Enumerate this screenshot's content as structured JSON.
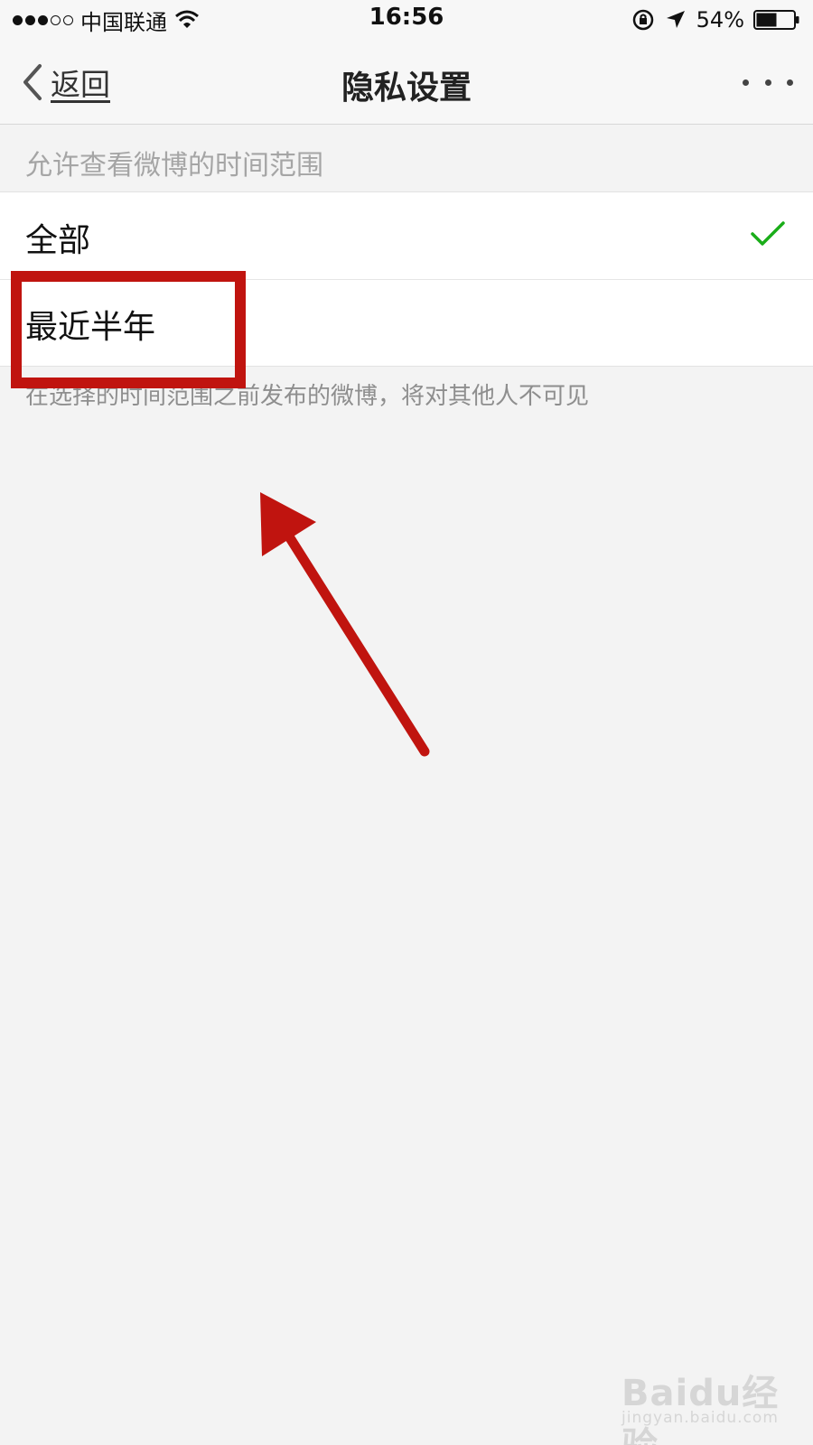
{
  "status_bar": {
    "carrier": "中国联通",
    "time": "16:56",
    "battery": "54%",
    "signal_bars_filled": 3,
    "signal_bars_total": 5
  },
  "nav": {
    "back_label": "返回",
    "title": "隐私设置",
    "more_icon": "more-dots-icon"
  },
  "section": {
    "header": "允许查看微博的时间范围",
    "options": [
      {
        "label": "全部",
        "selected": true
      },
      {
        "label": "最近半年",
        "selected": false
      }
    ],
    "footer": "在选择的时间范围之前发布的微博，将对其他人不可见"
  },
  "colors": {
    "check": "#1aad19",
    "annotation": "#c0140f",
    "background": "#f3f3f3"
  },
  "watermark": {
    "logo": "Baidu经验",
    "url": "jingyan.baidu.com"
  }
}
